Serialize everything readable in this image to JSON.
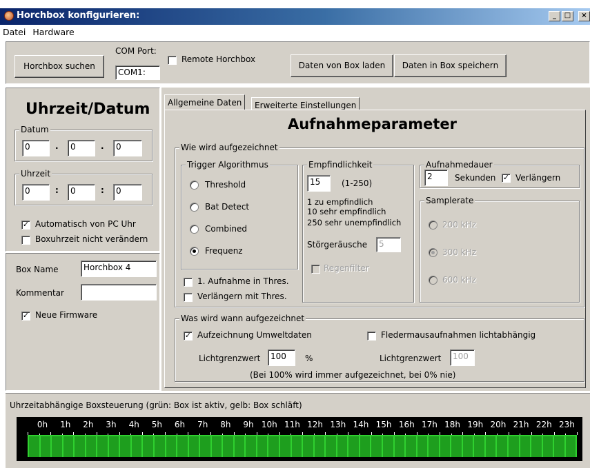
{
  "window": {
    "title": "Horchbox konfigurieren:",
    "minimize": "_",
    "maximize": "□",
    "close": "×"
  },
  "menu": [
    "Datei",
    "Hardware"
  ],
  "toolbar": {
    "search_button": "Horchbox suchen",
    "com_port_label": "COM Port:",
    "com_port_value": "COM1:",
    "remote_label": "Remote Horchbox",
    "load_button": "Daten von Box laden",
    "save_button": "Daten in Box speichern"
  },
  "clock": {
    "heading": "Uhrzeit/Datum",
    "date_group": "Datum",
    "date_values": [
      "0",
      "0",
      "0"
    ],
    "time_group": "Uhrzeit",
    "time_values": [
      "0",
      "0",
      "0"
    ],
    "auto_pc_label": "Automatisch von PC Uhr",
    "auto_pc_checked": true,
    "keep_time_label": "Boxuhrzeit nicht verändern",
    "keep_time_checked": false
  },
  "box": {
    "name_label": "Box Name",
    "name_value": "Horchbox 4",
    "comment_label": "Kommentar",
    "comment_value": "",
    "firmware_label": "Neue Firmware",
    "firmware_checked": true
  },
  "tabs": [
    "Allgemeine Daten",
    "Erweiterte Einstellungen"
  ],
  "params": {
    "heading": "Aufnahmeparameter",
    "how_group": "Wie wird aufgezeichnet",
    "trigger_group": "Trigger Algorithmus",
    "trigger_options": [
      "Threshold",
      "Bat Detect",
      "Combined",
      "Frequenz"
    ],
    "trigger_selected": "Frequenz",
    "first_thres_label": "1. Aufnahme in Thres.",
    "extend_thres_label": "Verlängern mit Thres.",
    "sens_group": "Empfindlichkeit",
    "sens_value": "15",
    "sens_range": "(1-250)",
    "sens_hint": [
      "1 zu empfindlich",
      "10 sehr empfindlich",
      "250 sehr unempfindlich"
    ],
    "noise_label": "Störgeräusche",
    "noise_value": "5",
    "rain_label": "Regenfilter",
    "duration_group": "Aufnahmedauer",
    "duration_value": "2",
    "duration_unit": "Sekunden",
    "extend_label": "Verlängern",
    "extend_checked": true,
    "samplerate_group": "Samplerate",
    "samplerate_options": [
      "200 kHz",
      "300 kHz",
      "600 kHz"
    ],
    "samplerate_selected": "300 kHz",
    "when_group": "Was wird wann aufgezeichnet",
    "env_label": "Aufzeichnung Umweltdaten",
    "env_checked": true,
    "bat_light_label": "Fledermausaufnahmen lichtabhängig",
    "bat_light_checked": false,
    "light_label": "Lichtgrenzwert",
    "light_value": "100",
    "light_unit": "%",
    "light2_label": "Lichtgrenzwert",
    "light2_value": "100",
    "note": "(Bei 100% wird immer aufgezeichnet, bei 0% nie)"
  },
  "schedule": {
    "title": "Uhrzeitabhängige Boxsteuerung (grün: Box ist aktiv, gelb: Box schläft)",
    "hours": [
      "0h",
      "1h",
      "2h",
      "3h",
      "4h",
      "5h",
      "6h",
      "7h",
      "8h",
      "9h",
      "10h",
      "11h",
      "12h",
      "13h",
      "14h",
      "15h",
      "16h",
      "17h",
      "18h",
      "19h",
      "20h",
      "21h",
      "22h",
      "23h"
    ],
    "active_color": "#1e9e1e"
  }
}
